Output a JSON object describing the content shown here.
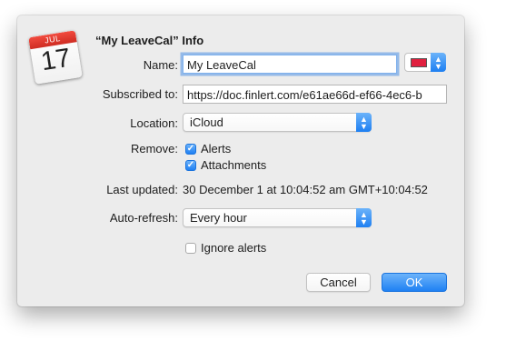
{
  "dialog": {
    "title": "“My LeaveCal” Info",
    "icon": {
      "name": "calendar-icon",
      "month": "JUL",
      "day": "17"
    }
  },
  "fields": {
    "name_label": "Name:",
    "name_value": "My LeaveCal",
    "color_well": "#e0203f",
    "subscribed_label": "Subscribed to:",
    "subscribed_value": "https://doc.finlert.com/e61ae66d-ef66-4ec6-b",
    "location_label": "Location:",
    "location_value": "iCloud",
    "remove_label": "Remove:",
    "remove_alerts": "Alerts",
    "remove_alerts_checked": true,
    "remove_attachments": "Attachments",
    "remove_attachments_checked": true,
    "last_updated_label": "Last updated:",
    "last_updated_value": "30 December 1 at 10:04:52 am GMT+10:04:52",
    "auto_refresh_label": "Auto-refresh:",
    "auto_refresh_value": "Every hour",
    "ignore_alerts": "Ignore alerts",
    "ignore_alerts_checked": false
  },
  "buttons": {
    "cancel": "Cancel",
    "ok": "OK"
  },
  "colors": {
    "accent": "#1f81f3",
    "dialog_background": "#ececec"
  }
}
